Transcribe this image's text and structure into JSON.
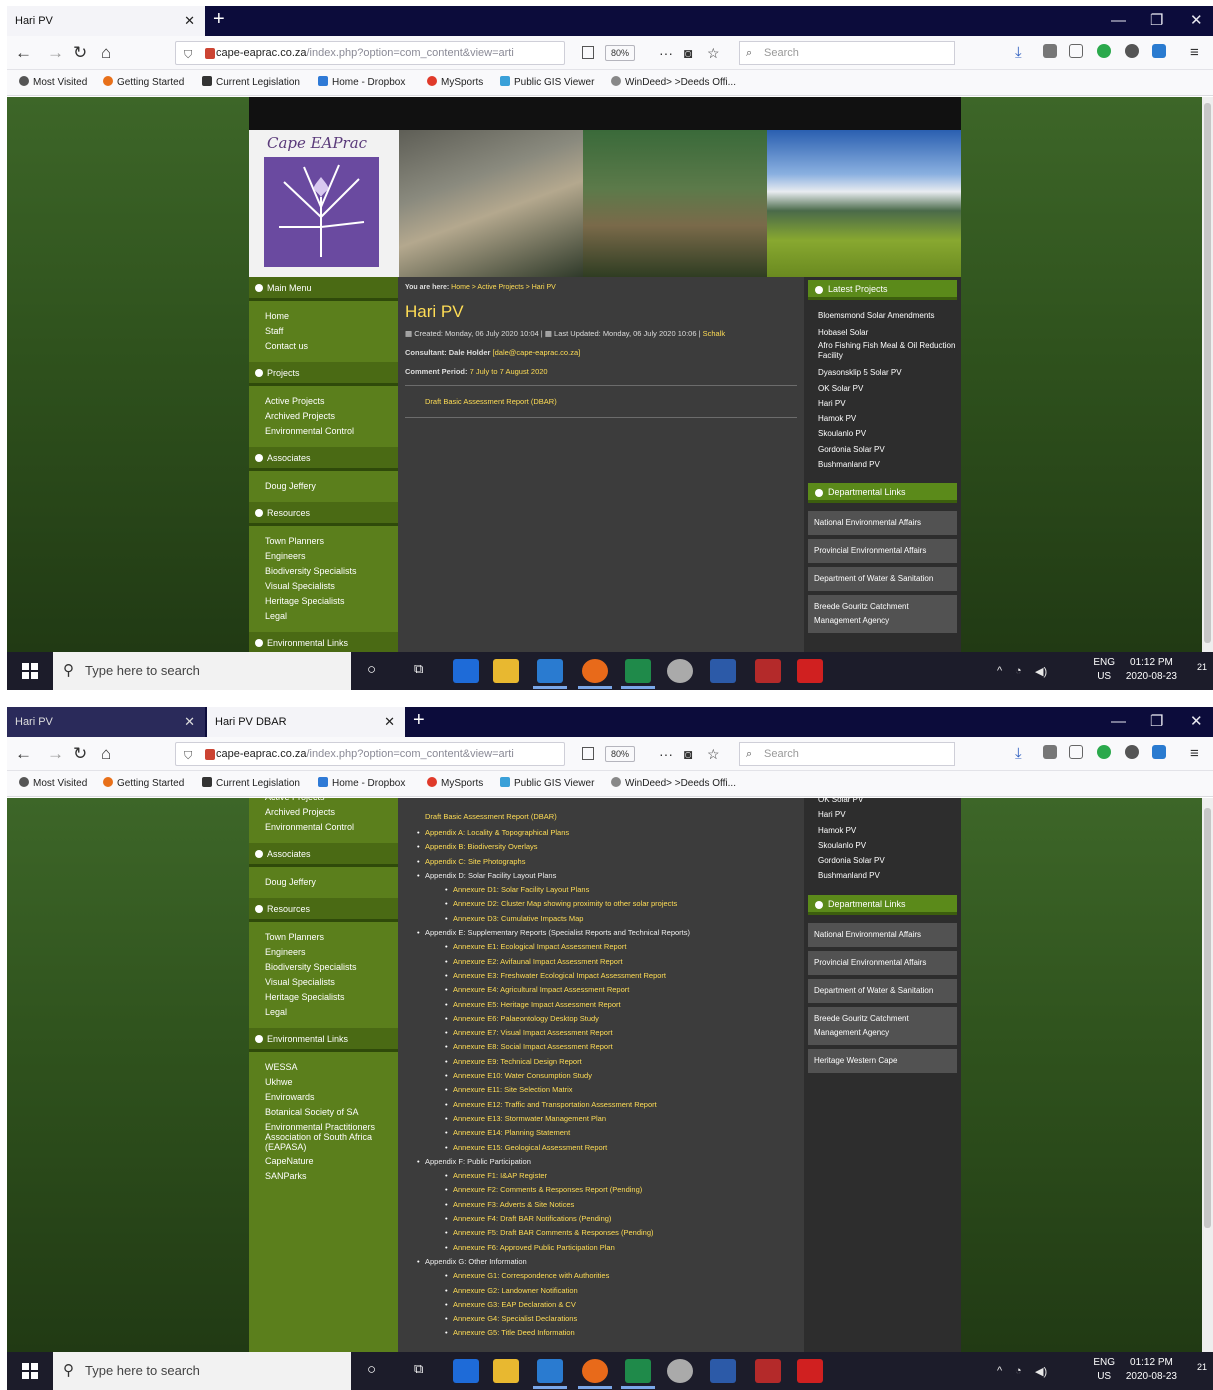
{
  "browser": {
    "tabs_s1": [
      {
        "title": "Hari PV"
      }
    ],
    "tabs_s2": [
      {
        "title": "Hari PV"
      },
      {
        "title": "Hari PV DBAR"
      }
    ],
    "url_host": "cape-eaprac.co.za",
    "url_path": "/index.php?option=com_content&view=arti",
    "zoom": "80%",
    "search_placeholder": "Search",
    "bookmarks": [
      "Most Visited",
      "Getting Started",
      "Current Legislation",
      "Home - Dropbox",
      "MySports",
      "Public GIS Viewer",
      "WinDeed> >Deeds Offi..."
    ]
  },
  "site": {
    "logo_text": "Cape EAPrac",
    "left_menu": {
      "main_menu_title": "Main Menu",
      "main_items": [
        "Home",
        "Staff",
        "Contact us"
      ],
      "projects_title": "Projects",
      "projects_items": [
        "Active Projects",
        "Archived Projects",
        "Environmental Control"
      ],
      "associates_title": "Associates",
      "associates_items": [
        "Doug Jeffery"
      ],
      "resources_title": "Resources",
      "resources_items": [
        "Town Planners",
        "Engineers",
        "Biodiversity Specialists",
        "Visual Specialists",
        "Heritage Specialists",
        "Legal"
      ],
      "env_links_title": "Environmental Links",
      "env_links_items": [
        "WESSA",
        "Ukhwe",
        "Envirowards",
        "Botanical Society of SA",
        "Environmental Practitioners Association of South Africa (EAPASA)",
        "CapeNature",
        "SANParks"
      ]
    },
    "article": {
      "breadcrumb_label": "You are here:",
      "breadcrumb": "Home > Active Projects > Hari PV",
      "title": "Hari PV",
      "created": "Created: Monday, 06 July 2020 10:04",
      "updated": "Last Updated: Monday, 06 July 2020 10:06",
      "author": "Schalk",
      "consultant_label": "Consultant: Dale Holder",
      "consultant_email": "[dale@cape-eaprac.co.za]",
      "comment_label": "Comment Period:",
      "comment_period": "7 July to 7 August 2020",
      "draft_report": "Draft Basic Assessment Report (DBAR)",
      "appendices": [
        {
          "label": "Appendix A: Locality & Topographical Plans",
          "link": true,
          "annexures": []
        },
        {
          "label": "Appendix B: Biodiversity Overlays",
          "link": true,
          "annexures": []
        },
        {
          "label": "Appendix C: Site Photographs",
          "link": true,
          "annexures": []
        },
        {
          "label": "Appendix D: Solar Facility Layout Plans",
          "link": false,
          "annexures": [
            "Annexure D1: Solar Facility Layout Plans",
            "Annexure D2: Cluster Map showing proximity to other solar projects",
            "Annexure D3: Cumulative Impacts Map"
          ]
        },
        {
          "label": "Appendix E: Supplementary Reports (Specialist Reports and Technical Reports)",
          "link": false,
          "annexures": [
            "Annexure E1: Ecological Impact Assessment Report",
            "Annexure E2: Avifaunal Impact Assessment Report",
            "Annexure E3: Freshwater Ecological Impact Assessment Report",
            "Annexure E4: Agricultural Impact Assessment Report",
            "Annexure E5: Heritage Impact Assessment Report",
            "Annexure E6: Palaeontology Desktop Study",
            "Annexure E7: Visual Impact Assessment Report",
            "Annexure E8: Social Impact Assessment Report",
            "Annexure E9: Technical Design Report",
            "Annexure E10: Water Consumption Study",
            "Annexure E11: Site Selection Matrix",
            "Annexure E12: Traffic and Transportation Assessment Report",
            "Annexure E13: Stormwater Management Plan",
            "Annexure E14: Planning Statement",
            "Annexure E15: Geological Assessment Report"
          ]
        },
        {
          "label": "Appendix F: Public Participation",
          "link": false,
          "annexures": [
            "Annexure F1: I&AP Register",
            "Annexure F2: Comments & Responses Report (Pending)",
            "Annexure F3: Adverts & Site Notices",
            "Annexure F4: Draft BAR Notifications (Pending)",
            "Annexure F5: Draft BAR Comments & Responses (Pending)",
            "Annexure F6: Approved Public Participation Plan"
          ]
        },
        {
          "label": "Appendix G: Other Information",
          "link": false,
          "annexures": [
            "Annexure G1: Correspondence with Authorities",
            "Annexure G2: Landowner Notification",
            "Annexure G3: EAP Declaration & CV",
            "Annexure G4: Specialist Declarations",
            "Annexure G5: Title Deed Information"
          ]
        }
      ]
    },
    "right_col": {
      "latest_title": "Latest Projects",
      "latest_items": [
        "Bloemsmond Solar Amendments",
        "Hobasel Solar",
        "Afro Fishing Fish Meal & Oil Reduction Facility",
        "Dyasonsklip 5 Solar PV",
        "OK Solar PV",
        "Hari PV",
        "Hamok PV",
        "Skoulanlo PV",
        "Gordonia Solar PV",
        "Bushmanland PV"
      ],
      "dept_title": "Departmental Links",
      "dept_items": [
        "National Environmental Affairs",
        "Provincial Environmental Affairs",
        "Department of Water & Sanitation",
        "Breede Gouritz Catchment Management Agency",
        "Heritage Western Cape"
      ]
    }
  },
  "taskbar": {
    "search_placeholder": "Type here to search",
    "lang_top": "ENG",
    "lang_bottom": "US",
    "time": "01:12 PM",
    "date": "2020-08-23",
    "notif_count": "21"
  }
}
